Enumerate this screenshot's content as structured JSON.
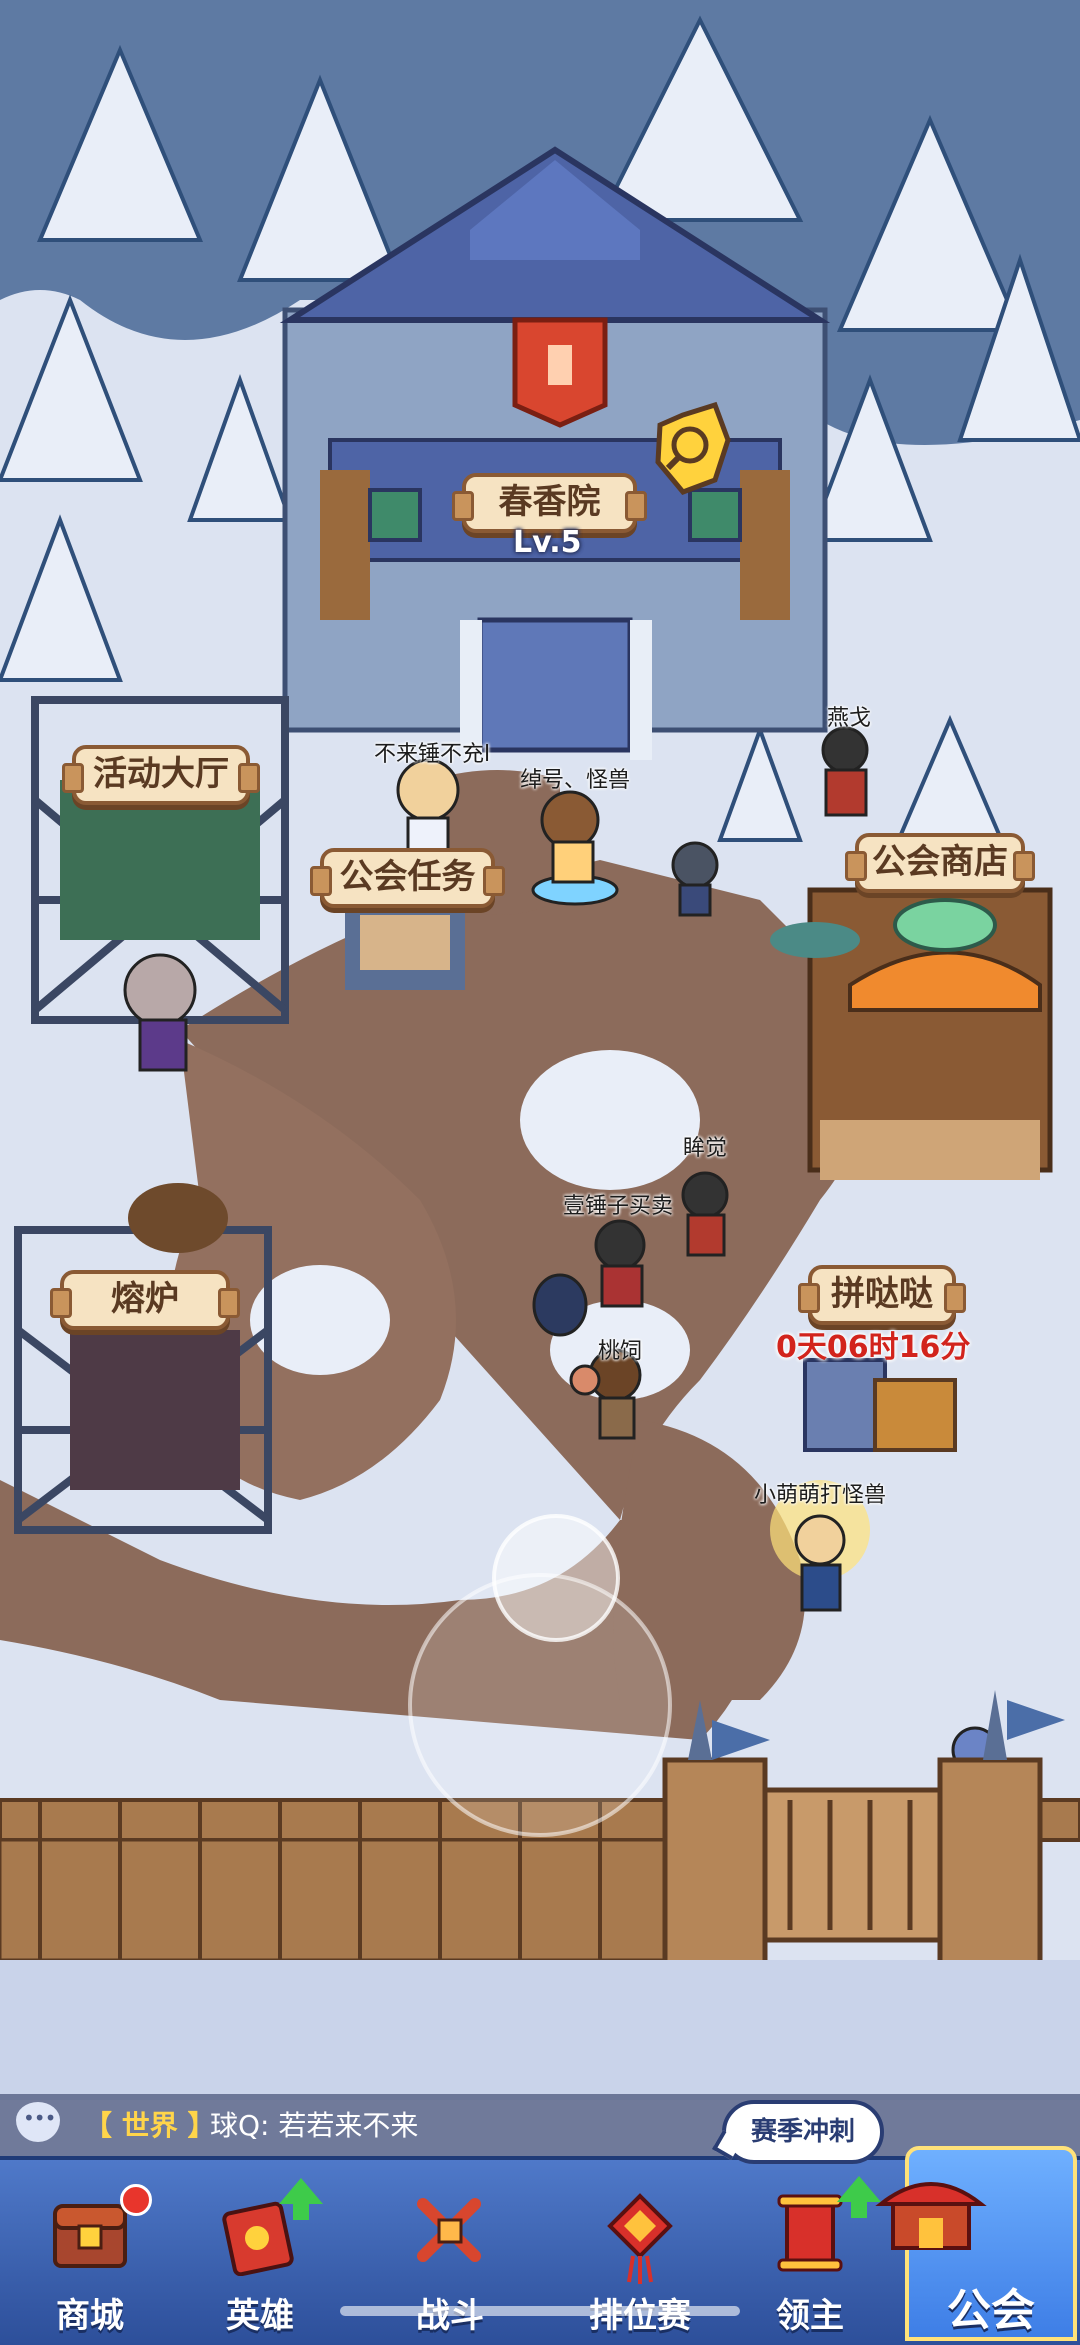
{
  "guild_hall": {
    "name": "春香院",
    "level": "Lv.5"
  },
  "buildings": {
    "activity_hall": "活动大厅",
    "guild_tasks": "公会任务",
    "guild_shop": "公会商店",
    "furnace": "熔炉",
    "pindada": "拼哒哒"
  },
  "event_timer": "0天06时16分",
  "players": [
    "不来锤不充l",
    "绰号、怪兽",
    "燕戈",
    "眸觉",
    "壹锤子买卖",
    "桃饲",
    "小萌萌打怪兽"
  ],
  "chat": {
    "channel": "【 世界 】",
    "message": "球Q:  若若来不来"
  },
  "season_bubble": "赛季冲刺",
  "nav": {
    "shop": "商城",
    "heroes": "英雄",
    "battle": "战斗",
    "ranked": "排位赛",
    "lord": "领主",
    "guild": "公会"
  },
  "colors": {
    "snow": "#e9eef8",
    "path": "#8b6a58",
    "tree": "#2f6f7a",
    "nav": "#3d64b5",
    "timer": "#d2241c"
  }
}
